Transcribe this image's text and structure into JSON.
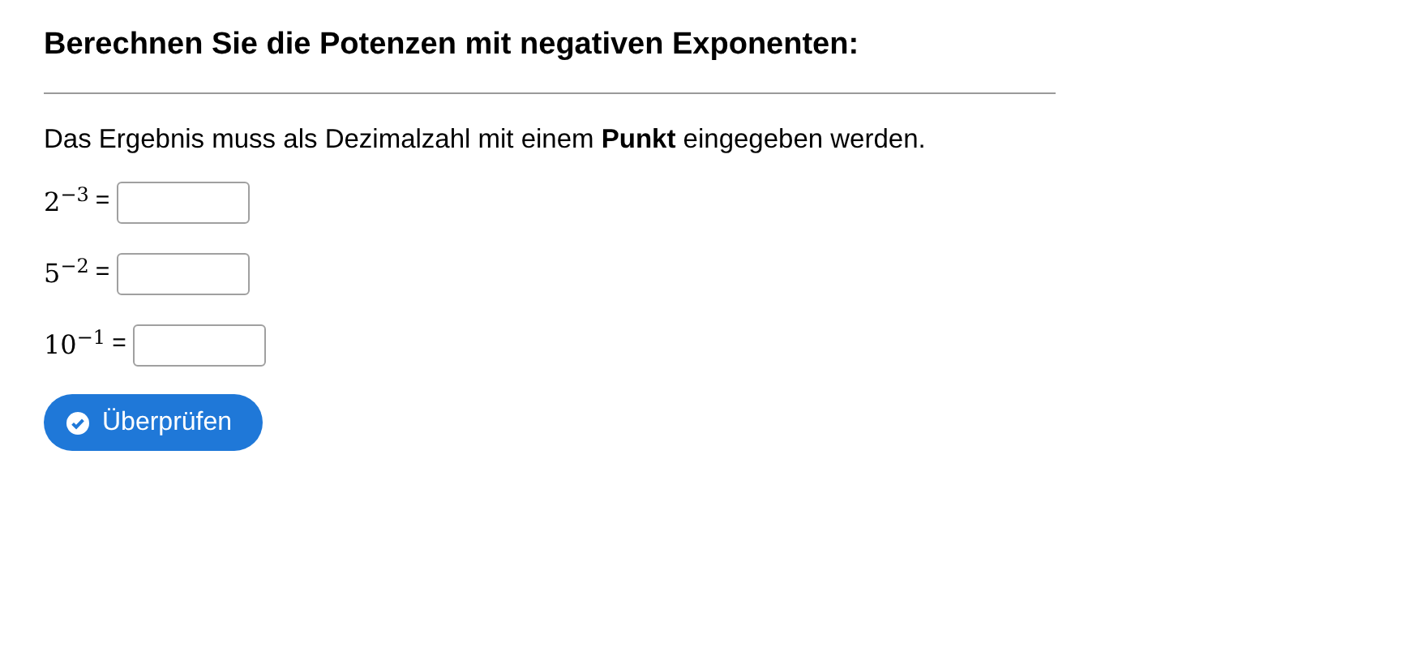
{
  "title": "Berechnen Sie die Potenzen mit negativen Exponenten:",
  "instruction": "Das Ergebnis muss als Dezimalzahl mit einem **Punkt** eingegeben werden.",
  "exercises": [
    {
      "expression": "2$^{−3}$",
      "equals": "="
    },
    {
      "expression": "5$^{−2}$",
      "equals": "="
    },
    {
      "expression": "10$^{−1}$",
      "equals": "="
    }
  ],
  "button": {
    "label": "Überprüfen"
  }
}
